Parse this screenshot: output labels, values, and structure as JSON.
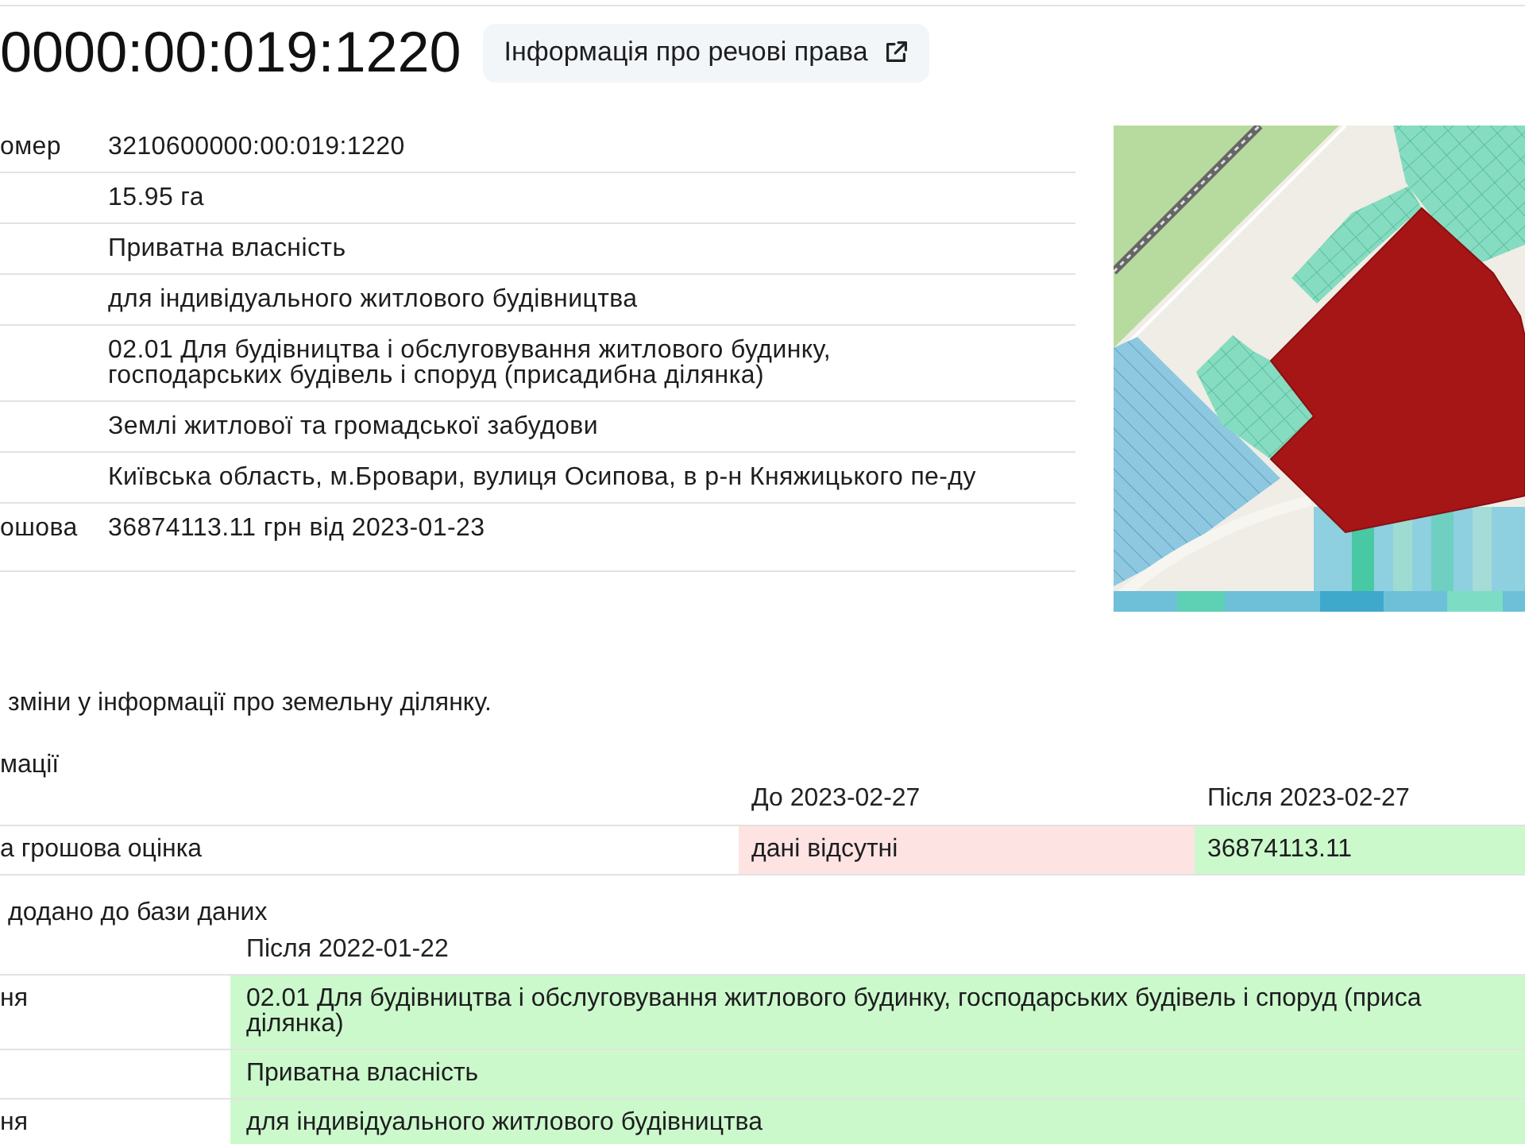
{
  "header": {
    "title": "0000:00:019:1220",
    "rights_button": {
      "label": "Інформація про речові права"
    }
  },
  "parcel_info": {
    "rows": [
      {
        "label": "омер",
        "value": "3210600000:00:019:1220"
      },
      {
        "value": "15.95 га"
      },
      {
        "value": "Приватна власність"
      },
      {
        "value": "для індивідуального житлового будівництва"
      },
      {
        "value": "02.01 Для будівництва і обслуговування житлового будинку,\nгосподарських будівель і споруд (присадибна ділянка)"
      },
      {
        "value": "Землі житлової та громадської забудови"
      },
      {
        "value": "Київська область, м.Бровари, вулиця Осипова, в р-н Княжицького пе-ду"
      },
      {
        "label": "ошова",
        "value": "36874113.11 грн від 2023-01-23"
      }
    ]
  },
  "changes": {
    "note": "зміни у інформації про земельну ділянку.",
    "sections": [
      {
        "heading": "мації",
        "columns": [
          "До 2023-02-27",
          "Після 2023-02-27"
        ],
        "rows": [
          {
            "label": "а грошова оцінка",
            "cells": [
              {
                "text": "дані відсутні",
                "kind": "old"
              },
              {
                "text": "36874113.11",
                "kind": "new"
              }
            ]
          }
        ]
      },
      {
        "heading": "додано до бази даних",
        "columns": [
          "Після 2022-01-22"
        ],
        "rows": [
          {
            "label": "ня",
            "cells": [
              {
                "text": "02.01 Для будівництва і обслуговування житлового будинку, господарських будівель і споруд (приса\nділянка)",
                "kind": "new"
              }
            ]
          },
          {
            "cells": [
              {
                "text": "Приватна власність",
                "kind": "new"
              }
            ]
          },
          {
            "label": "ня",
            "cells": [
              {
                "text": "для індивідуального житлового будівництва",
                "kind": "new"
              }
            ]
          }
        ]
      }
    ]
  }
}
